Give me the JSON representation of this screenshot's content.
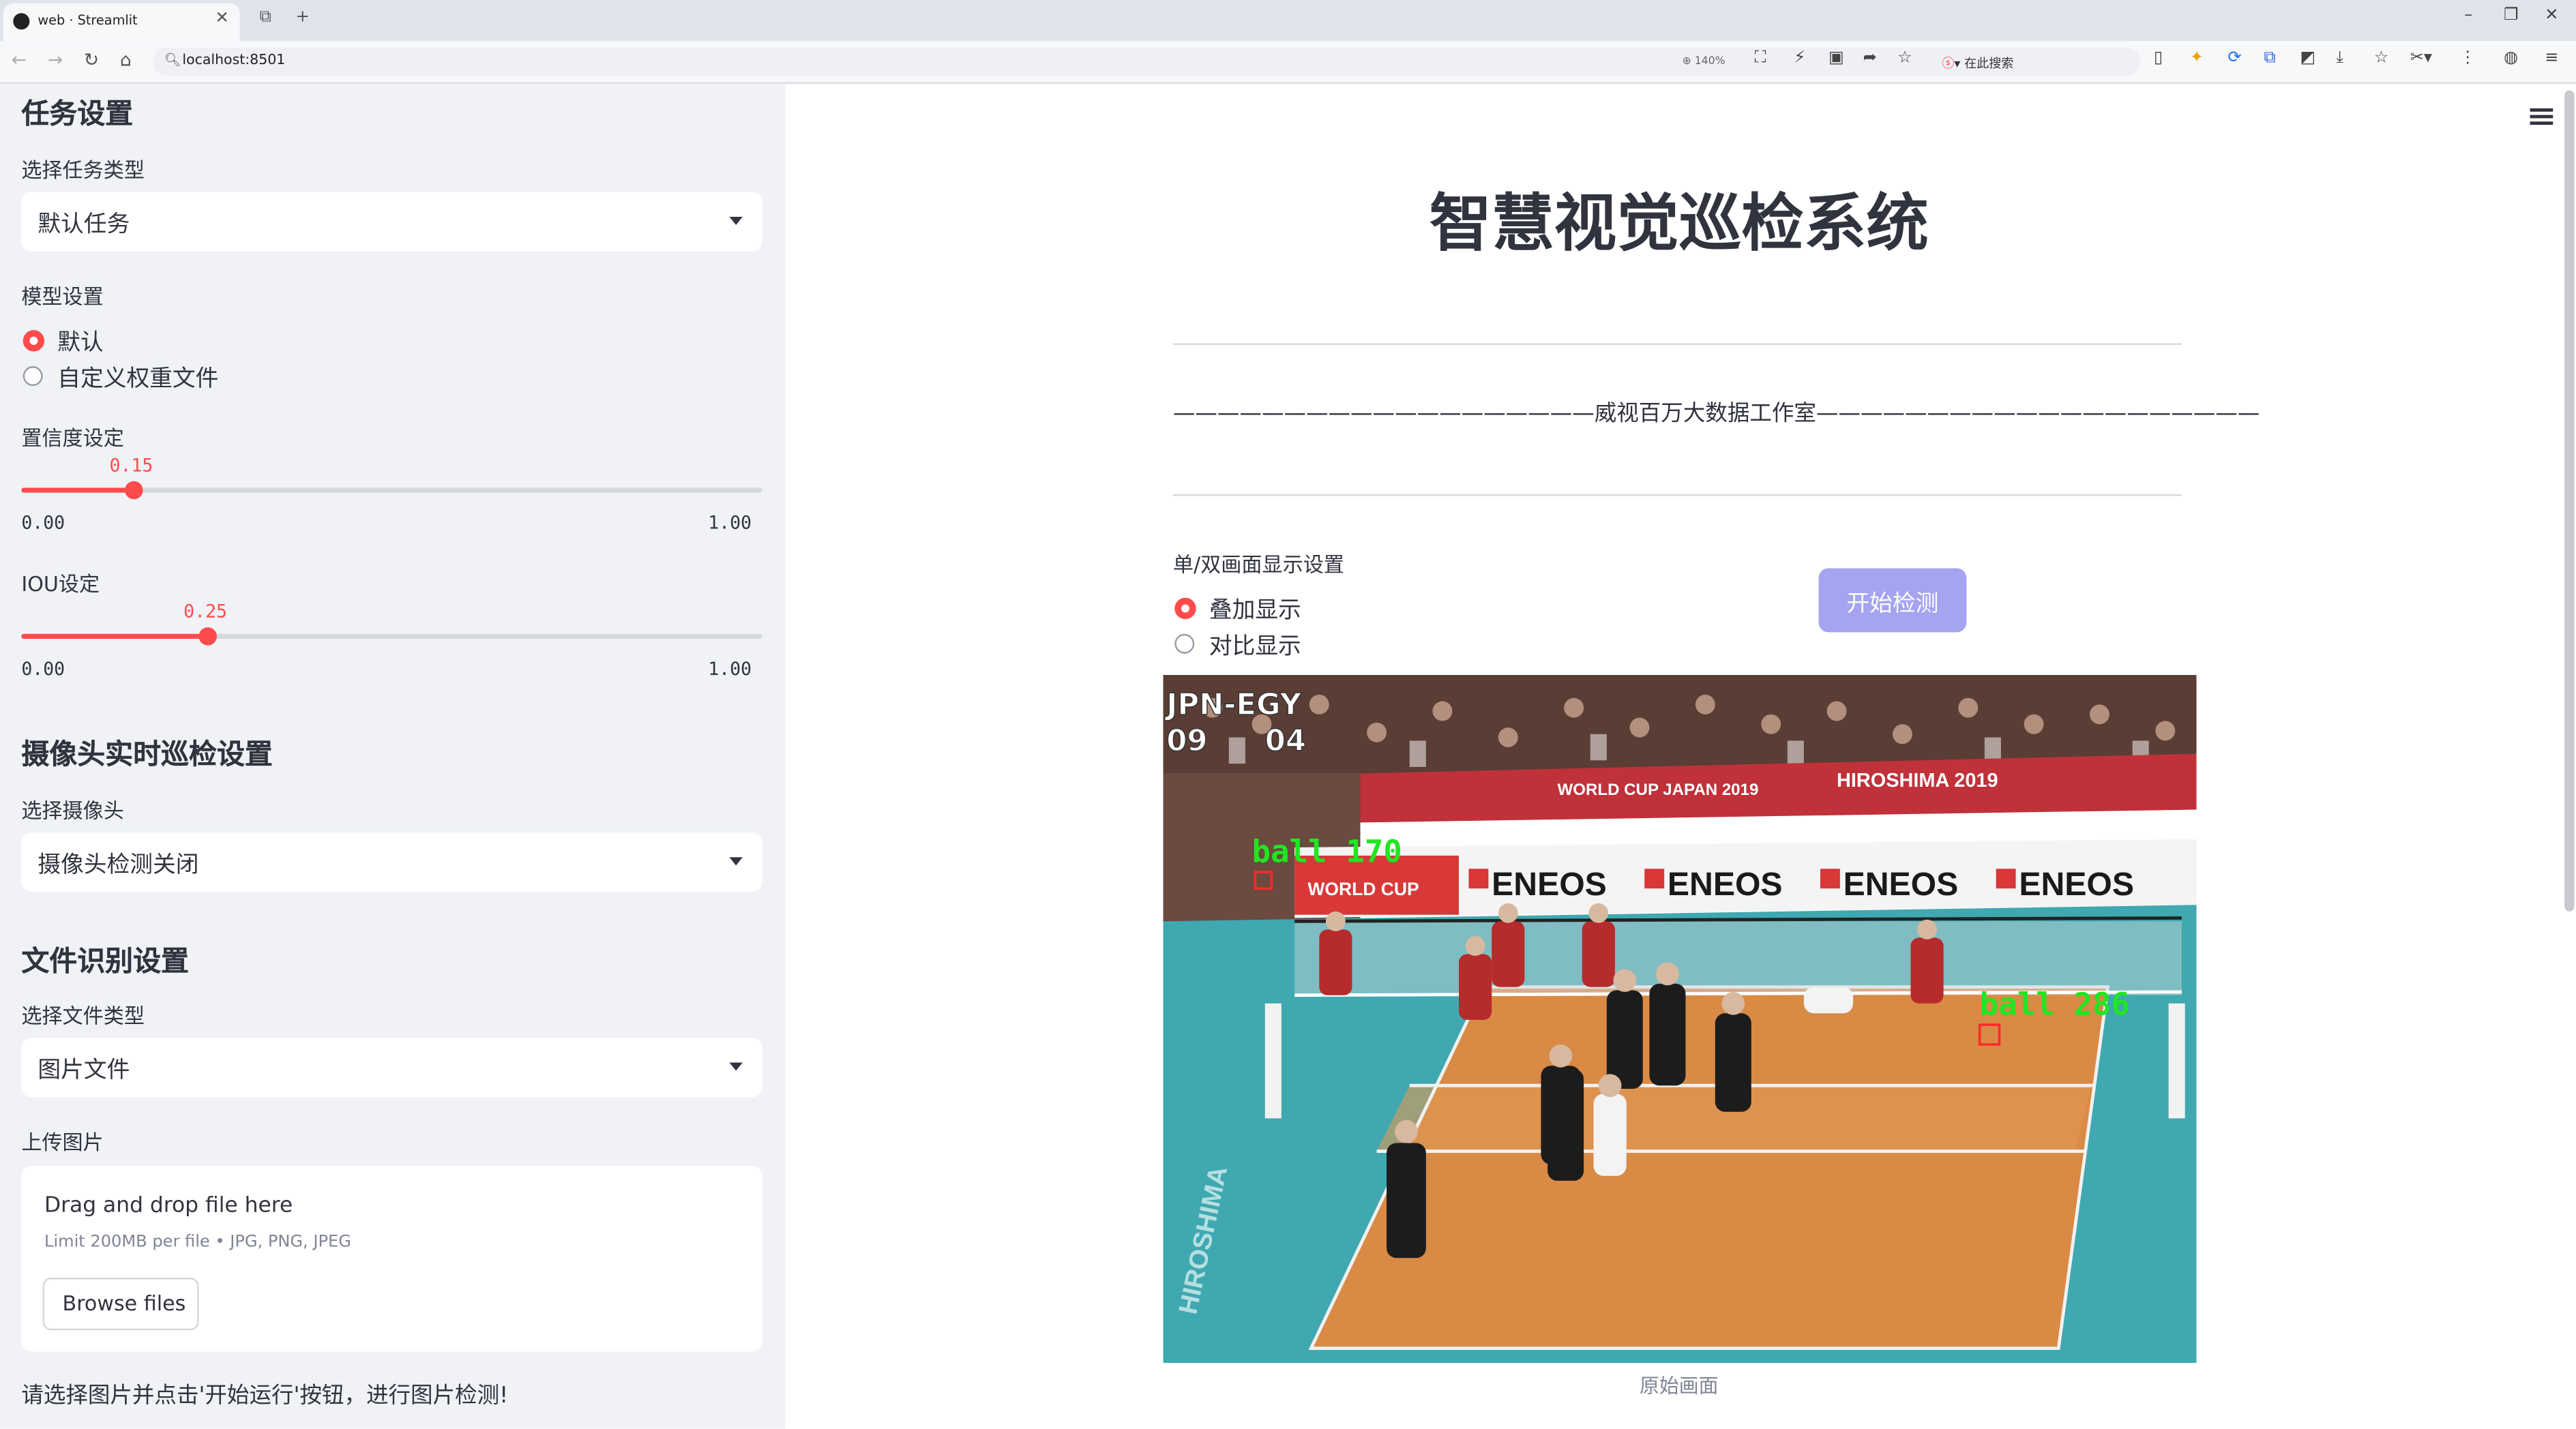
{
  "browser": {
    "tab_title": "web · Streamlit",
    "url": "localhost:8501",
    "zoom": "140%",
    "search_label": "在此搜索"
  },
  "sidebar": {
    "task_section": "任务设置",
    "task_type_label": "选择任务类型",
    "task_type_value": "默认任务",
    "model_label": "模型设置",
    "model_options": [
      "默认",
      "自定义权重文件"
    ],
    "model_selected": "默认",
    "conf_label": "置信度设定",
    "conf_value": 0.15,
    "conf_value_text": "0.15",
    "conf_min": "0.00",
    "conf_max": "1.00",
    "iou_label": "IOU设定",
    "iou_value": 0.25,
    "iou_value_text": "0.25",
    "iou_min": "0.00",
    "iou_max": "1.00",
    "camera_section": "摄像头实时巡检设置",
    "camera_label": "选择摄像头",
    "camera_value": "摄像头检测关闭",
    "file_section": "文件识别设置",
    "file_type_label": "选择文件类型",
    "file_type_value": "图片文件",
    "upload_label": "上传图片",
    "upload_main": "Drag and drop file here",
    "upload_sub": "Limit 200MB per file • JPG, PNG, JPEG",
    "browse_label": "Browse files",
    "note": "请选择图片并点击'开始运行'按钮，进行图片检测!"
  },
  "main": {
    "title": "智慧视觉巡检系统",
    "subtitle": "———————————————————威视百万大数据工作室————————————————————",
    "display_label": "单/双画面显示设置",
    "display_options": [
      "叠加显示",
      "对比显示"
    ],
    "display_selected": "叠加显示",
    "start_button": "开始检测",
    "caption": "原始画面",
    "scene": {
      "scoreboard_team": "JPN-EGY",
      "score_left": "09",
      "score_right": "04",
      "banner_left": "WORLD CUP JAPAN 2019",
      "banner_right": "HIROSHIMA 2019",
      "sponsor": "ENEOS",
      "cup_sign": "WORLD CUP",
      "detections": [
        {
          "label": "ball 170"
        },
        {
          "label": "ball 286"
        }
      ]
    }
  }
}
